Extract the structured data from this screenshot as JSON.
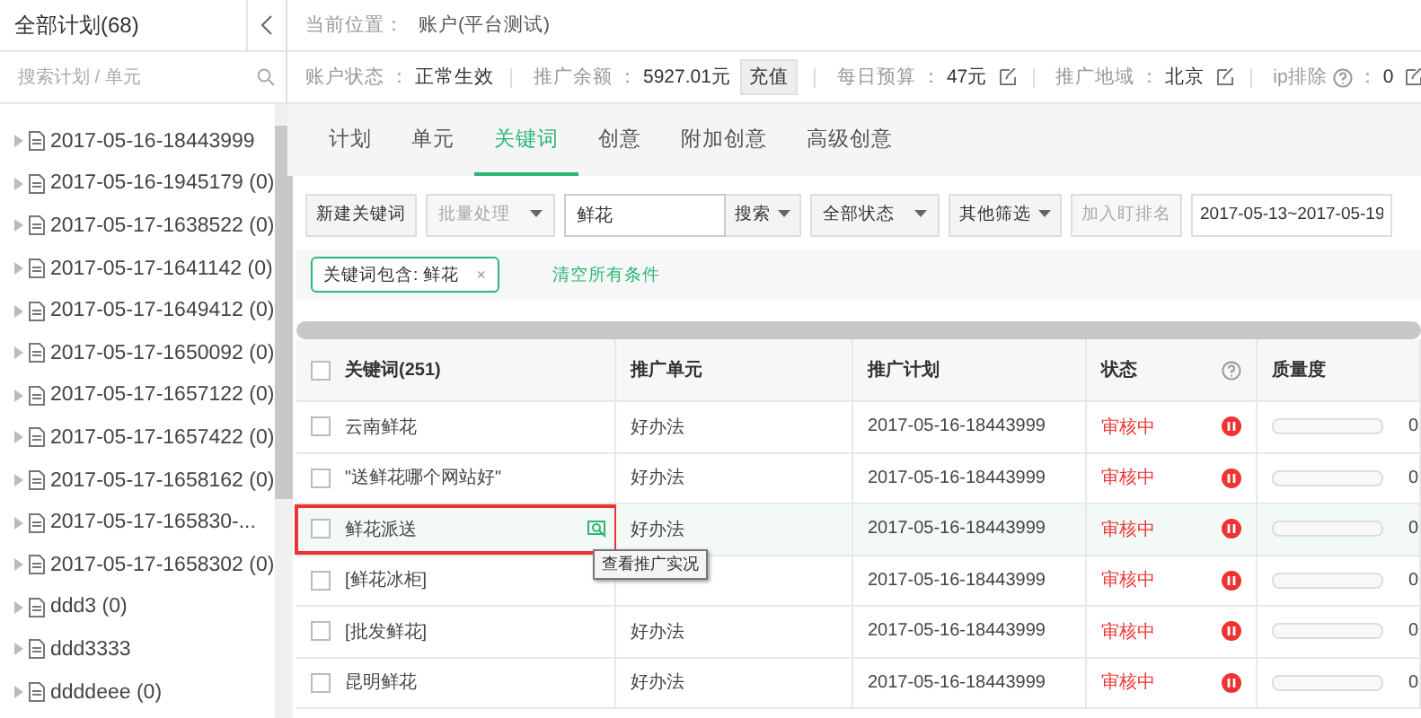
{
  "sidebar": {
    "title": "全部计划(68)",
    "search": {
      "placeholder": "搜索计划 / 单元"
    },
    "tree": [
      {
        "label": "2017-05-16-18443999",
        "expanded": false
      },
      {
        "label": "2017-05-16-1945179 (0)",
        "expanded": false
      },
      {
        "label": "2017-05-17-1638522 (0)",
        "expanded": false
      },
      {
        "label": "2017-05-17-1641142 (0)",
        "expanded": false
      },
      {
        "label": "2017-05-17-1649412 (0)",
        "expanded": false
      },
      {
        "label": "2017-05-17-1650092 (0)",
        "expanded": false
      },
      {
        "label": "2017-05-17-1657122 (0)",
        "expanded": false
      },
      {
        "label": "2017-05-17-1657422 (0)",
        "expanded": false
      },
      {
        "label": "2017-05-17-1658162 (0)",
        "expanded": false
      },
      {
        "label": "2017-05-17-165830-...",
        "expanded": false
      },
      {
        "label": "2017-05-17-1658302 (0)",
        "expanded": false
      },
      {
        "label": "ddd3 (0)",
        "expanded": false
      },
      {
        "label": "ddd3333",
        "expanded": false
      },
      {
        "label": "ddddeee (0)",
        "expanded": false
      }
    ]
  },
  "breadcrumb": {
    "label": "当前位置：",
    "value": "账户(平台测试)"
  },
  "account": [
    {
      "label": "账户状态",
      "colon": "：",
      "value": "正常生效"
    },
    {
      "label": "推广余额",
      "colon": "：",
      "value": "5927.01元",
      "action": "充值"
    },
    {
      "label": "每日预算",
      "colon": "：",
      "value": "47元",
      "editable": true
    },
    {
      "label": "推广地域",
      "colon": "：",
      "value": "北京",
      "editable": true
    },
    {
      "label": "ip排除",
      "help": true,
      "colon": "：",
      "value": "0",
      "editable": true
    }
  ],
  "tabs": [
    {
      "label": "计划",
      "selected": false
    },
    {
      "label": "单元",
      "selected": false
    },
    {
      "label": "关键词",
      "selected": true
    },
    {
      "label": "创意",
      "selected": false
    },
    {
      "label": "附加创意",
      "selected": false
    },
    {
      "label": "高级创意",
      "selected": false
    }
  ],
  "toolbar": {
    "new_button": "新建关键词",
    "batch": {
      "label": "批量处理",
      "disabled": true
    },
    "search": {
      "value": "鲜花"
    },
    "search_type": "搜索",
    "status_filter": "全部状态",
    "other_filter": "其他筛选",
    "rank_button": {
      "label": "加入盯排名",
      "disabled": true
    },
    "date_range": "2017-05-13~2017-05-19"
  },
  "filters": {
    "tags": [
      {
        "label": "关键词包含: 鲜花",
        "remove": "×"
      }
    ],
    "clear": "清空所有条件"
  },
  "table": {
    "columns": [
      {
        "label": "关键词(251)",
        "kind": "check",
        "checked": false
      },
      {
        "label": "推广单元",
        "kind": "text"
      },
      {
        "label": "推广计划",
        "kind": "text"
      },
      {
        "label": "状态",
        "kind": "help"
      },
      {
        "label": "质量度",
        "kind": "text"
      }
    ],
    "rows": [
      {
        "checked": false,
        "hovered": false,
        "keyword": "云南鲜花",
        "unit": "好办法",
        "plan": "2017-05-16-18443999",
        "status": "审核中",
        "level": 0,
        "quality": "0"
      },
      {
        "checked": false,
        "hovered": false,
        "keyword": "\"送鲜花哪个网站好\"",
        "unit": "好办法",
        "plan": "2017-05-16-18443999",
        "status": "审核中",
        "level": 0,
        "quality": "0"
      },
      {
        "checked": false,
        "hovered": true,
        "keyword": "鲜花派送",
        "unit": "好办法",
        "plan": "2017-05-16-18443999",
        "status": "审核中",
        "level": 0,
        "quality": "0",
        "tooltip": "查看推广实况"
      },
      {
        "checked": false,
        "hovered": false,
        "keyword": "[鲜花冰柜]",
        "plan": "2017-05-16-18443999",
        "status": "审核中",
        "level": 0,
        "quality": "0"
      },
      {
        "checked": false,
        "hovered": false,
        "keyword": "[批发鲜花]",
        "unit": "好办法",
        "plan": "2017-05-16-18443999",
        "status": "审核中",
        "level": 0,
        "quality": "0"
      },
      {
        "checked": false,
        "hovered": false,
        "keyword": "昆明鲜花",
        "unit": "好办法",
        "plan": "2017-05-16-18443999",
        "status": "审核中",
        "level": 0,
        "quality": "0"
      }
    ]
  }
}
